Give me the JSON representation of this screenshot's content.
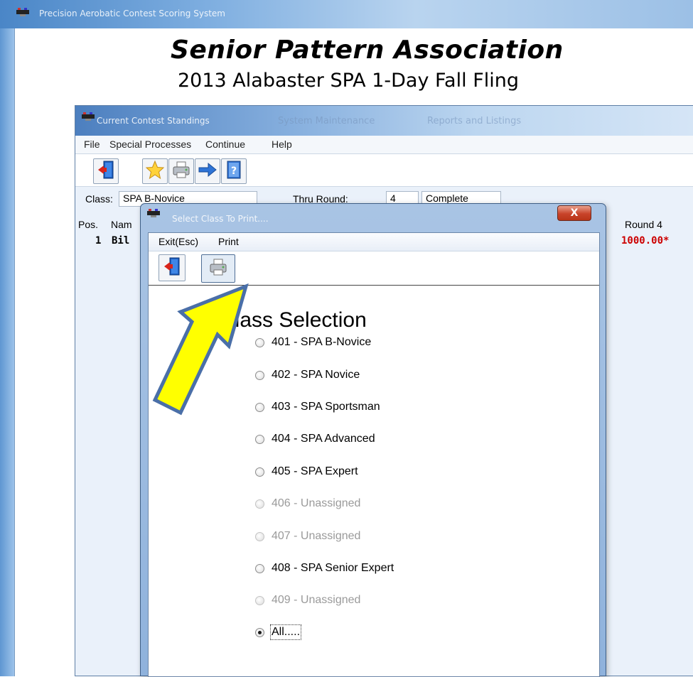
{
  "main_window": {
    "title": "Precision Aerobatic Contest Scoring System",
    "header_title": "Senior Pattern Association",
    "header_subtitle": "2013 Alabaster SPA 1-Day Fall Fling"
  },
  "standings_window": {
    "title": "Current Contest Standings",
    "ghost_tabs": [
      "System Maintenance",
      "Reports and Listings"
    ],
    "menu": [
      "File",
      "Special Processes",
      "Continue",
      "Help"
    ],
    "toolbar_icons": [
      "exit-door-icon",
      "star-icon",
      "printer-icon",
      "arrow-right-icon",
      "help-book-icon"
    ],
    "class_label": "Class:",
    "class_value": "SPA B-Novice",
    "thru_round_label": "Thru Round:",
    "thru_round_value": "4",
    "status_value": "Complete",
    "headers": {
      "pos": "Pos.",
      "name": "Nam",
      "round4": "Round 4"
    },
    "row": {
      "pos": "1",
      "name": "Bil",
      "round4": "1000.00*"
    }
  },
  "dialog": {
    "title": "Select Class To Print....",
    "close_label": "X",
    "menu": {
      "exit": "Exit(Esc)",
      "print": "Print"
    },
    "toolbar_icons": [
      "exit-door-icon",
      "printer-icon"
    ],
    "section_title": "Class Selection",
    "options": [
      {
        "label": "401 - SPA B-Novice",
        "enabled": true,
        "checked": false
      },
      {
        "label": "402 - SPA Novice",
        "enabled": true,
        "checked": false
      },
      {
        "label": "403 - SPA Sportsman",
        "enabled": true,
        "checked": false
      },
      {
        "label": "404 - SPA Advanced",
        "enabled": true,
        "checked": false
      },
      {
        "label": "405 - SPA Expert",
        "enabled": true,
        "checked": false
      },
      {
        "label": "406 - Unassigned",
        "enabled": false,
        "checked": false
      },
      {
        "label": "407 - Unassigned",
        "enabled": false,
        "checked": false
      },
      {
        "label": "408 - SPA Senior Expert",
        "enabled": true,
        "checked": false
      },
      {
        "label": "409 - Unassigned",
        "enabled": false,
        "checked": false
      },
      {
        "label": "All.....",
        "enabled": true,
        "checked": true
      }
    ]
  },
  "colors": {
    "titlebar_blue": "#4a86c7",
    "score_red": "#cc0000",
    "arrow_yellow": "#ffff00",
    "arrow_outline": "#4a6fa8"
  }
}
